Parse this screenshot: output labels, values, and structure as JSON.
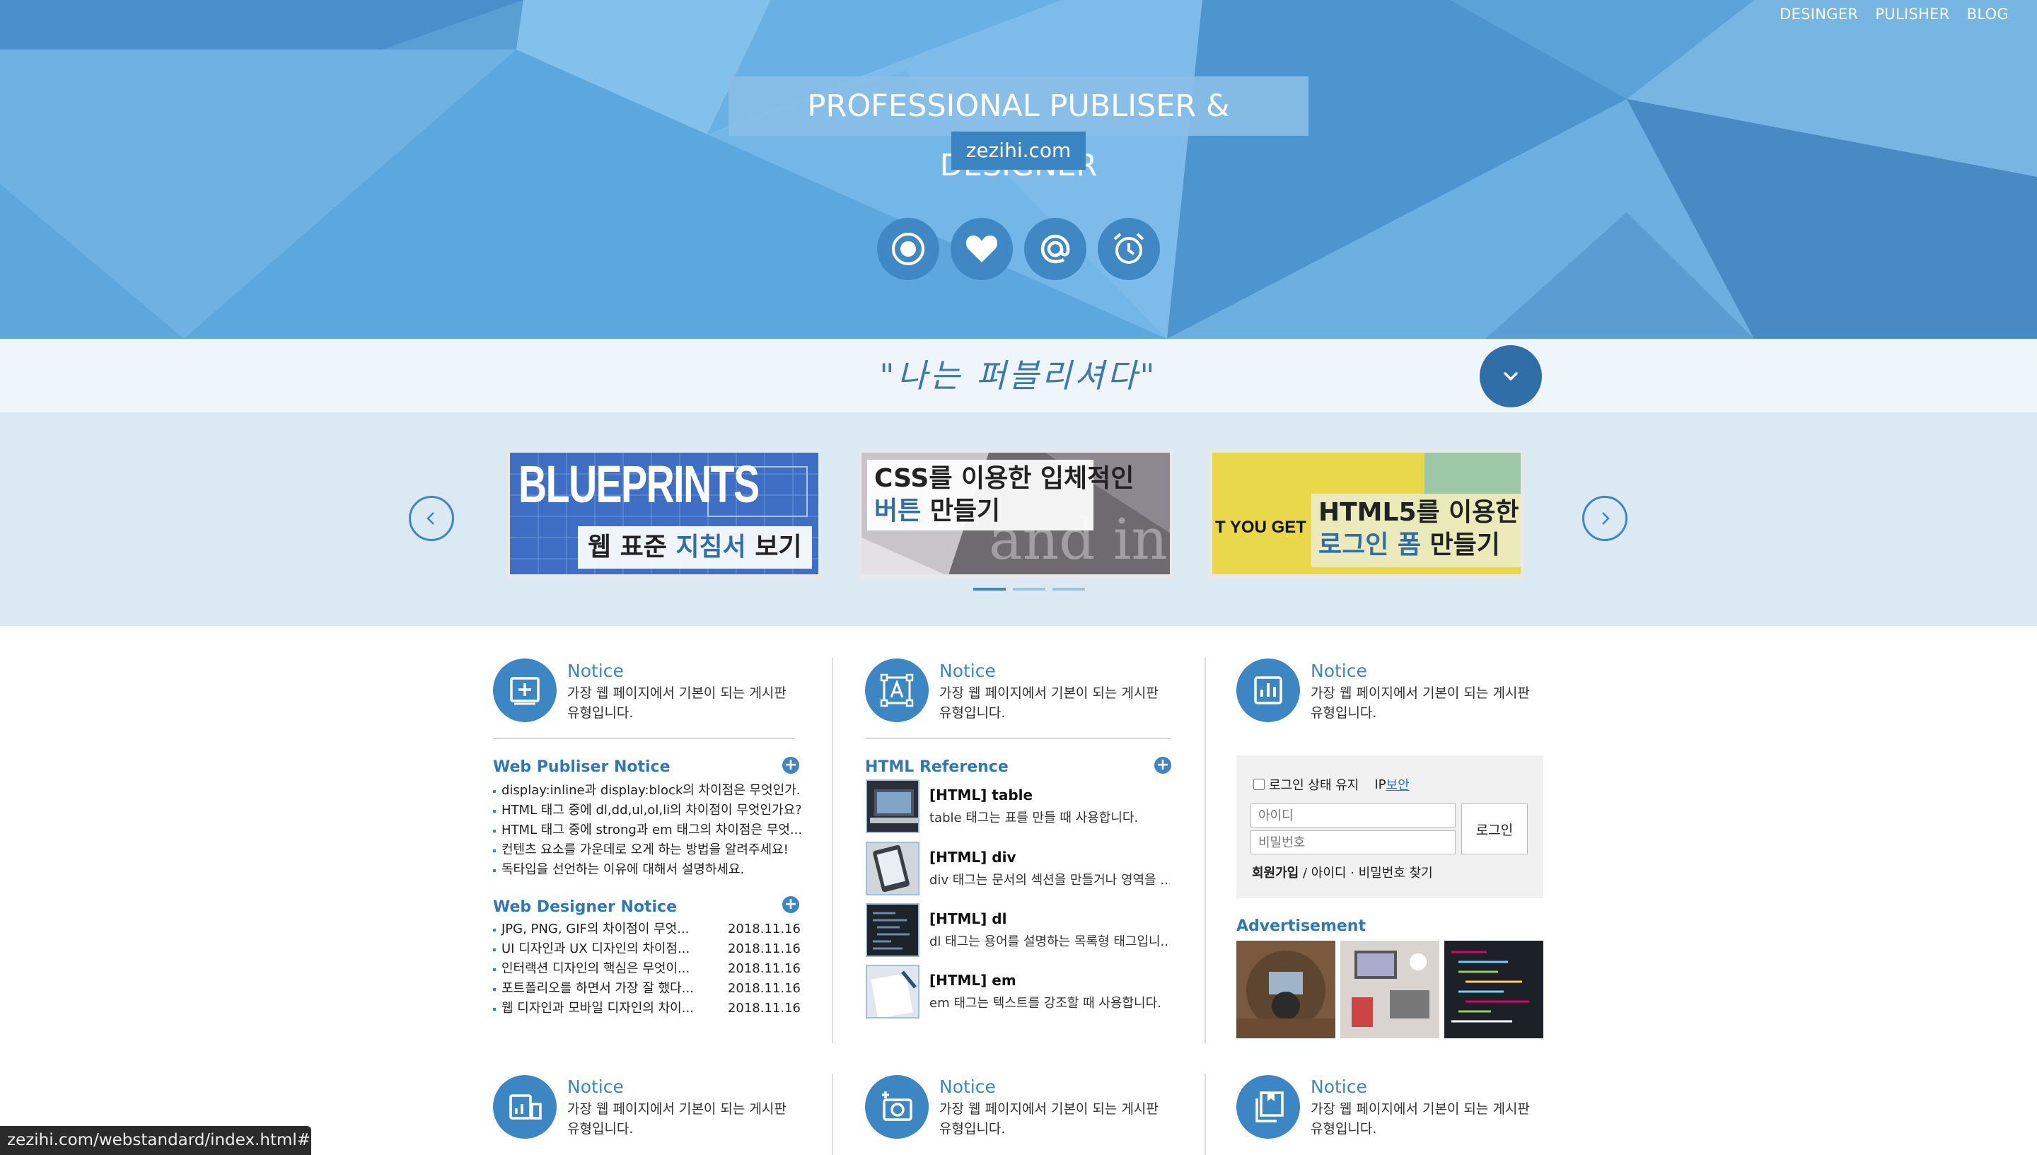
{
  "nav": {
    "items": [
      "DESINGER",
      "PULISHER",
      "BLOG"
    ]
  },
  "hero": {
    "title": "PROFESSIONAL PUBLISER & DESIGNER",
    "subtitle": "zezihi.com",
    "social_icons": [
      "record-icon",
      "heart-icon",
      "at-icon",
      "alarm-icon"
    ]
  },
  "quote": "\"나는 퍼블리셔다\"",
  "slider": {
    "slides": [
      {
        "heading": "BLUEPRINTS",
        "caption_a": "웹 표준 ",
        "caption_b": "지침서",
        "caption_c": " 보기"
      },
      {
        "caption_line1": "CSS를 이용한 입체적인",
        "caption_line2_a": "버튼",
        "caption_line2_b": " 만들기"
      },
      {
        "side_text": "T YOU GET",
        "caption_line1": "HTML5를 이용한",
        "caption_line2_a": "로그인 폼",
        "caption_line2_b": " 만들기"
      }
    ],
    "active_index": 0,
    "dot_count": 3
  },
  "notices_top": [
    {
      "title": "Notice",
      "desc": "가장 웹 페이지에서 기본이 되는 게시판 유형입니다.",
      "icon": "plus-square-icon"
    },
    {
      "title": "Notice",
      "desc": "가장 웹 페이지에서 기본이 되는 게시판 유형입니다.",
      "icon": "text-frame-icon"
    },
    {
      "title": "Notice",
      "desc": "가장 웹 페이지에서 기본이 되는 게시판 유형입니다.",
      "icon": "bar-chart-icon"
    }
  ],
  "publisher_notice": {
    "title": "Web Publiser Notice",
    "items": [
      "display:inline과 display:block의 차이점은 무엇인가...",
      "HTML 태그 중에 dl,dd,ul,ol,li의 차이점이 무엇인가요?",
      "HTML 태그 중에 strong과 em 태그의 차이점은 무엇...",
      "컨텐츠 요소를 가운데로 오게 하는 방법을 알려주세요!",
      "독타입을 선언하는 이유에 대해서 설명하세요."
    ]
  },
  "designer_notice": {
    "title": "Web Designer Notice",
    "items": [
      {
        "text": "JPG, PNG, GIF의 차이점이 무엇...",
        "date": "2018.11.16"
      },
      {
        "text": "UI 디자인과 UX 디자인의 차이점...",
        "date": "2018.11.16"
      },
      {
        "text": "인터랙션 디자인의 핵심은 무엇이...",
        "date": "2018.11.16"
      },
      {
        "text": "포트폴리오를 하면서 가장 잘 했다...",
        "date": "2018.11.16"
      },
      {
        "text": "웹 디자인과 모바일 디자인의 차이...",
        "date": "2018.11.16"
      }
    ]
  },
  "html_reference": {
    "title": "HTML Reference",
    "items": [
      {
        "title": "[HTML] table",
        "desc": "table 태그는 표를 만들 때 사용합니다."
      },
      {
        "title": "[HTML] div",
        "desc": "div 태그는 문서의 섹션을 만들거나 영역을 ..."
      },
      {
        "title": "[HTML] dl",
        "desc": "dl 태그는 용어를 설명하는 목록형 태그입니..."
      },
      {
        "title": "[HTML] em",
        "desc": "em 태그는 텍스트를 강조할 때 사용합니다."
      }
    ]
  },
  "login": {
    "keep_label": "로그인 상태 유지",
    "ip_label": "IP",
    "ip_link": "보안",
    "id_placeholder": "아이디",
    "pw_placeholder": "비밀번호",
    "button": "로그인",
    "join": "회원가입",
    "find": " / 아이디 · 비밀번호 찾기"
  },
  "advertisement": {
    "title": "Advertisement"
  },
  "notices_bottom": [
    {
      "title": "Notice",
      "desc": "가장 웹 페이지에서 기본이 되는 게시판 유형입니다.",
      "icon": "gallery-icon"
    },
    {
      "title": "Notice",
      "desc": "가장 웹 페이지에서 기본이 되는 게시판 유형입니다.",
      "icon": "camera-add-icon"
    },
    {
      "title": "Notice",
      "desc": "가장 웹 페이지에서 기본이 되는 게시판 유형입니다.",
      "icon": "copy-icon"
    }
  ],
  "status_url": "zezihi.com/webstandard/index.html#",
  "colors": {
    "accent": "#3c86c3",
    "dark_accent": "#2f6ea6",
    "hero_light": "#8cc4ec",
    "slider_bg": "#dbe9f3"
  }
}
